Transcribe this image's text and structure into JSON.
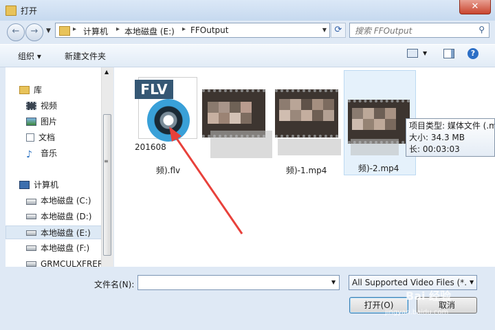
{
  "window": {
    "title": "打开",
    "close_glyph": "✕"
  },
  "nav": {
    "back_glyph": "←",
    "forward_glyph": "→",
    "recent_glyph": "▼",
    "refresh_glyph": "⟳"
  },
  "breadcrumbs": [
    "计算机",
    "本地磁盘 (E:)",
    "FFOutput"
  ],
  "search": {
    "placeholder": "搜索 FFOutput"
  },
  "toolbar": {
    "organize": "组织 ▾",
    "new_folder": "新建文件夹",
    "help": "?"
  },
  "sidebar": {
    "items": [
      {
        "label": "库",
        "icon": "library-icon"
      },
      {
        "label": "视频",
        "icon": "video-icon"
      },
      {
        "label": "图片",
        "icon": "pictures-icon"
      },
      {
        "label": "文档",
        "icon": "documents-icon"
      },
      {
        "label": "音乐",
        "icon": "music-icon"
      },
      {
        "label": "计算机",
        "icon": "computer-icon"
      },
      {
        "label": "本地磁盘 (C:)",
        "icon": "drive-icon"
      },
      {
        "label": "本地磁盘 (D:)",
        "icon": "drive-icon"
      },
      {
        "label": "本地磁盘 (E:)",
        "icon": "drive-icon",
        "selected": true
      },
      {
        "label": "本地磁盘 (F:)",
        "icon": "drive-icon"
      },
      {
        "label": "GRMCULXFRER",
        "icon": "drive-icon"
      }
    ]
  },
  "files": [
    {
      "name_line1": "201608",
      "name_line2": "频).flv",
      "badge": "FLV"
    },
    {
      "name_line1": "",
      "name_line2": ""
    },
    {
      "name_line1": "",
      "name_line2": "频)-1.mp4"
    },
    {
      "name_line1": "",
      "name_line2": "频)-2.mp4"
    }
  ],
  "tooltip": {
    "line1": "项目类型: 媒体文件 (.m",
    "line2": "大小: 34.3 MB",
    "line3": "长: 00:03:03"
  },
  "footer": {
    "filename_label": "文件名(N):",
    "filename_value": "",
    "filetype": "All Supported Video Files (*.",
    "open_button": "打开(O)",
    "cancel_button": "取消"
  },
  "watermark": {
    "text": "Bai 经验",
    "sub": "jingyan.baidu.com"
  },
  "colors": {
    "accent": "#e8413b",
    "selection": "#dde9f5",
    "window": "#dfe9f5"
  }
}
